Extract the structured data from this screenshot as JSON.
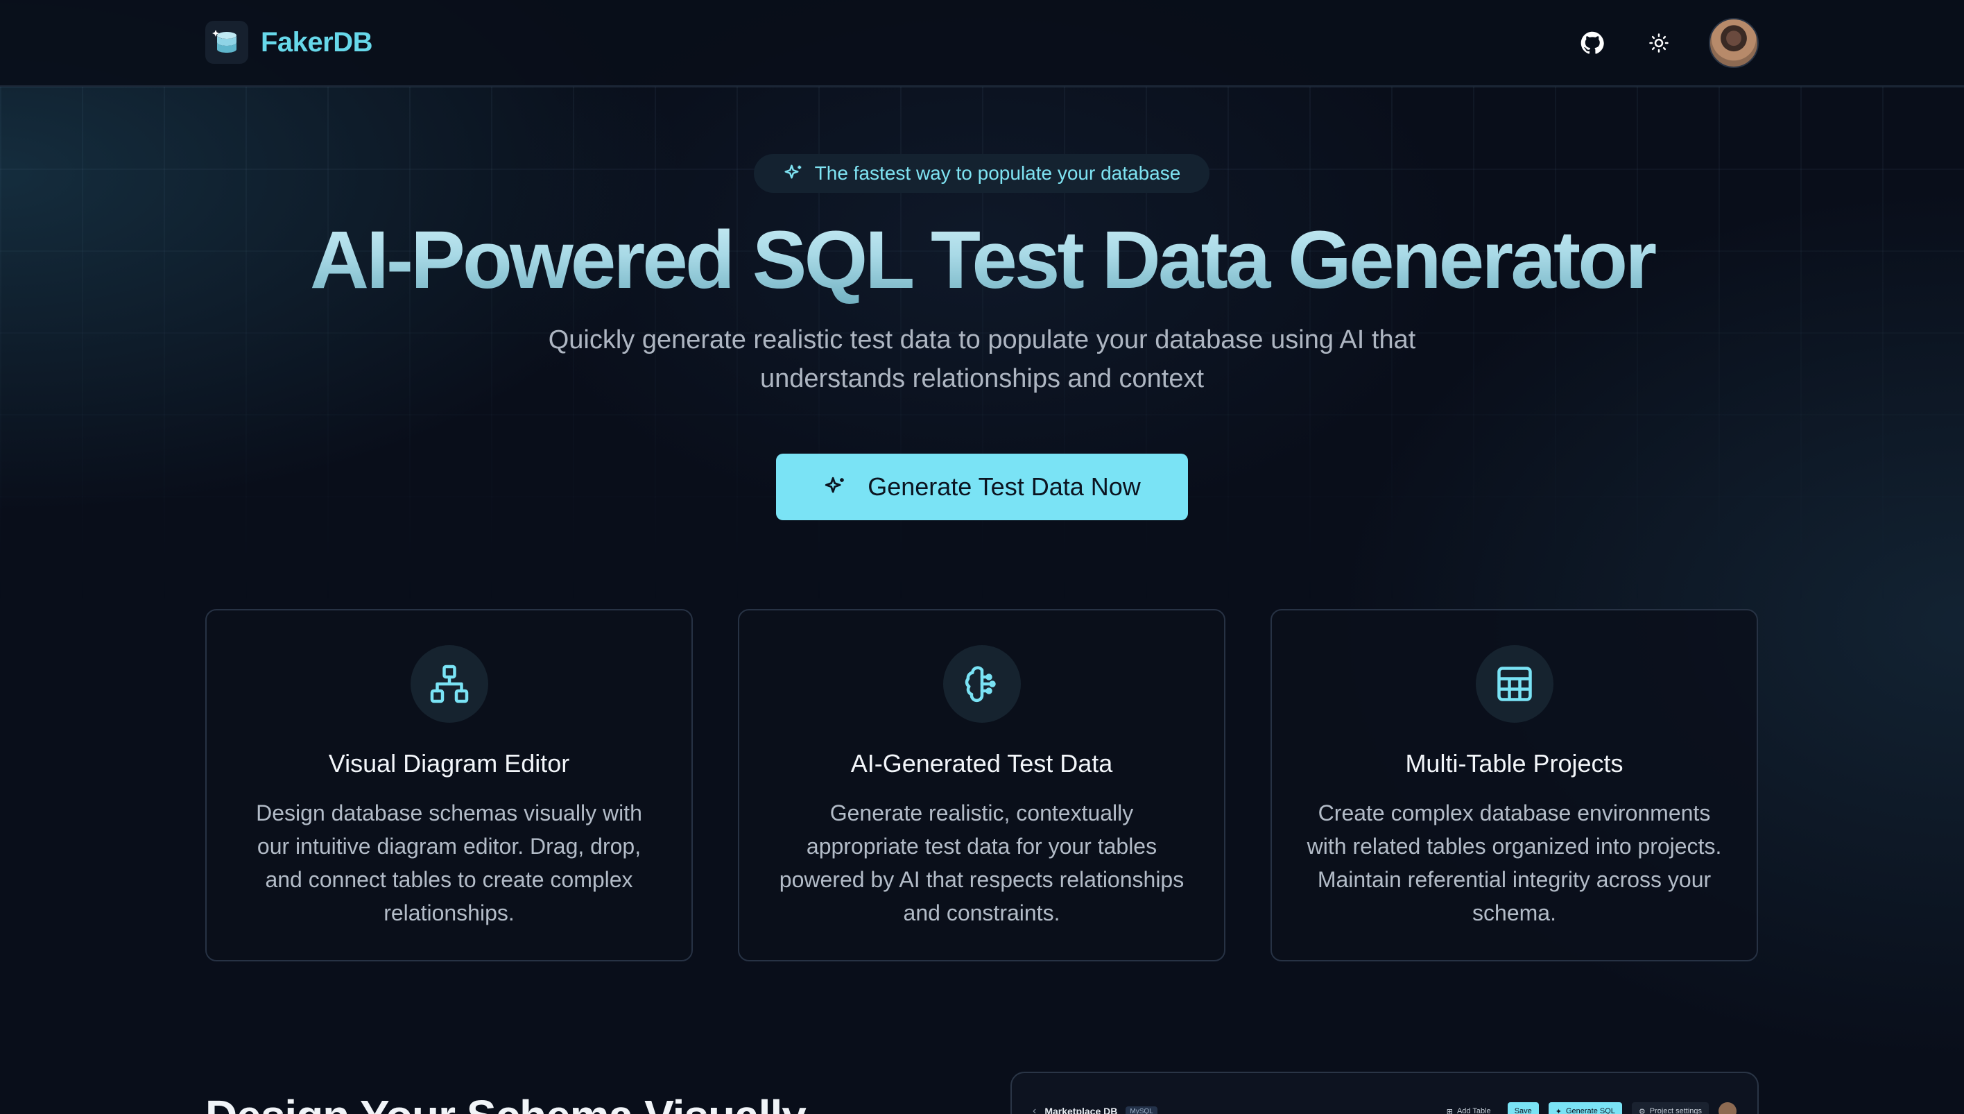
{
  "brand": {
    "name": "FakerDB"
  },
  "header": {
    "github_icon": "github-icon",
    "theme_icon": "sun-icon",
    "avatar": "user-avatar"
  },
  "hero": {
    "badge": "The fastest way to populate your database",
    "title": "AI-Powered SQL Test Data Generator",
    "subtitle": "Quickly generate realistic test data to populate your database using AI that understands relationships and context",
    "cta_label": "Generate Test Data Now"
  },
  "features": [
    {
      "icon": "diagram-icon",
      "title": "Visual Diagram Editor",
      "description": "Design database schemas visually with our intuitive diagram editor. Drag, drop, and connect tables to create complex relationships."
    },
    {
      "icon": "brain-icon",
      "title": "AI-Generated Test Data",
      "description": "Generate realistic, contextually appropriate test data for your tables powered by AI that respects relationships and constraints."
    },
    {
      "icon": "table-icon",
      "title": "Multi-Table Projects",
      "description": "Create complex database environments with related tables organized into projects. Maintain referential integrity across your schema."
    }
  ],
  "section": {
    "title": "Design Your Schema Visually"
  },
  "preview": {
    "project_title": "Marketplace DB",
    "db_tag": "MySQL",
    "add_table": "Add Table",
    "save": "Save",
    "generate_sql": "Generate SQL",
    "project_settings": "Project settings"
  },
  "colors": {
    "accent": "#7ae3f5",
    "background": "#090e1a",
    "brand": "#67d8ea"
  }
}
